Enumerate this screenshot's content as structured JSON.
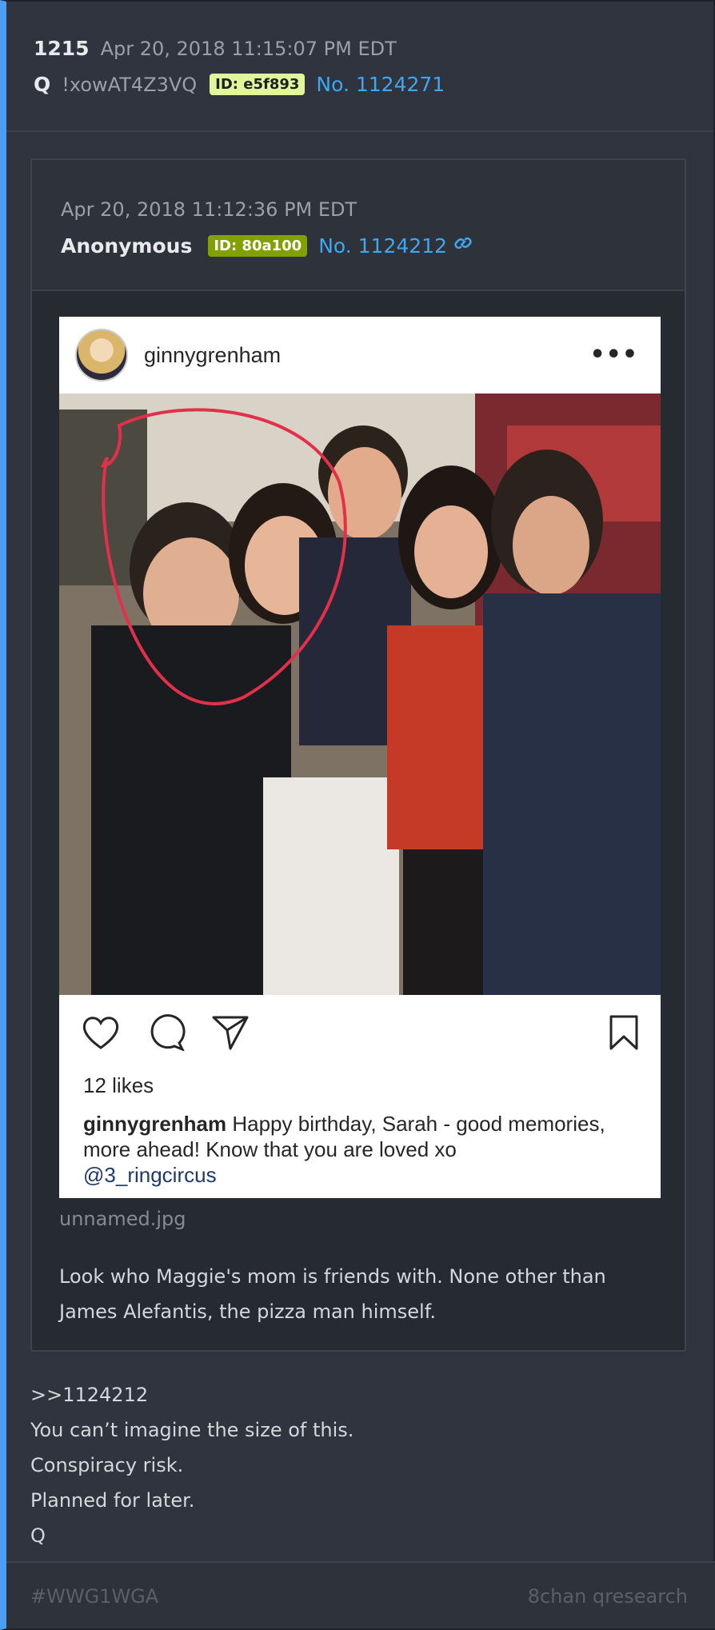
{
  "post": {
    "number": "1215",
    "timestamp": "Apr 20, 2018 11:15:07 PM EDT",
    "author": "Q",
    "tripcode": "!xowAT4Z3VQ",
    "id_label": "ID: e5f893",
    "id_color": "#e3f59a",
    "post_no": "No. 1124271",
    "lines": [
      ">>1124212",
      "You can’t imagine the size of this.",
      "Conspiracy risk.",
      "Planned for later.",
      "Q"
    ]
  },
  "quoted": {
    "timestamp": "Apr 20, 2018 11:12:36 PM EDT",
    "author": "Anonymous",
    "id_label": "ID: 80a100",
    "id_color": "#80a100",
    "post_no": "No. 1124212",
    "link_icon": "link-icon",
    "filename": "unnamed.jpg",
    "text": "Look who Maggie's mom is friends with. None other than James Alefantis, the pizza man himself."
  },
  "instagram": {
    "username": "ginnygrenham",
    "more_icon": "•••",
    "likes": "12 likes",
    "caption_user": "ginnygrenham",
    "caption_text": " Happy birthday, Sarah - good memories, more ahead! Know that you are loved xo",
    "mention": "@3_ringcircus"
  },
  "footer": {
    "tag": "#WWG1WGA",
    "board": "8chan qresearch"
  }
}
